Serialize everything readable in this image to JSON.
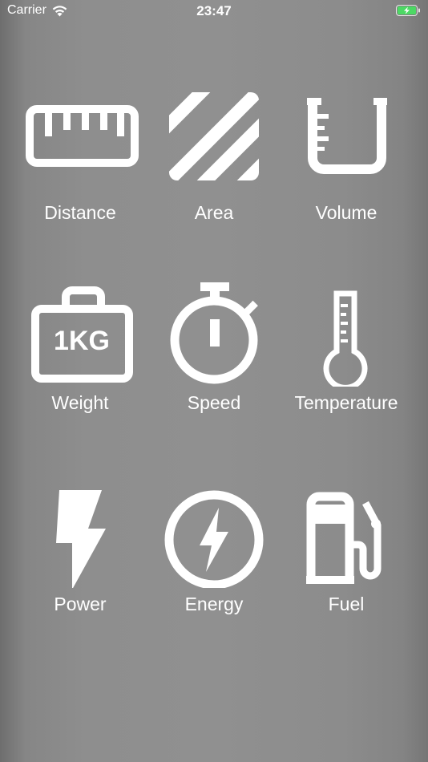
{
  "status_bar": {
    "carrier": "Carrier",
    "time": "23:47",
    "wifi_icon": "wifi-icon",
    "battery_icon": "battery-charging-icon",
    "battery_color": "#4cd964"
  },
  "grid": {
    "icon_color": "#ffffff",
    "items": [
      {
        "label": "Distance",
        "icon": "ruler-icon"
      },
      {
        "label": "Area",
        "icon": "area-stripes-icon"
      },
      {
        "label": "Volume",
        "icon": "beaker-icon"
      },
      {
        "label": "Weight",
        "icon": "weight-1kg-icon"
      },
      {
        "label": "Speed",
        "icon": "stopwatch-icon"
      },
      {
        "label": "Temperature",
        "icon": "thermometer-icon"
      },
      {
        "label": "Power",
        "icon": "lightning-bolt-icon"
      },
      {
        "label": "Energy",
        "icon": "energy-circle-bolt-icon"
      },
      {
        "label": "Fuel",
        "icon": "fuel-pump-icon"
      }
    ]
  },
  "weight_icon_text": "1KG"
}
